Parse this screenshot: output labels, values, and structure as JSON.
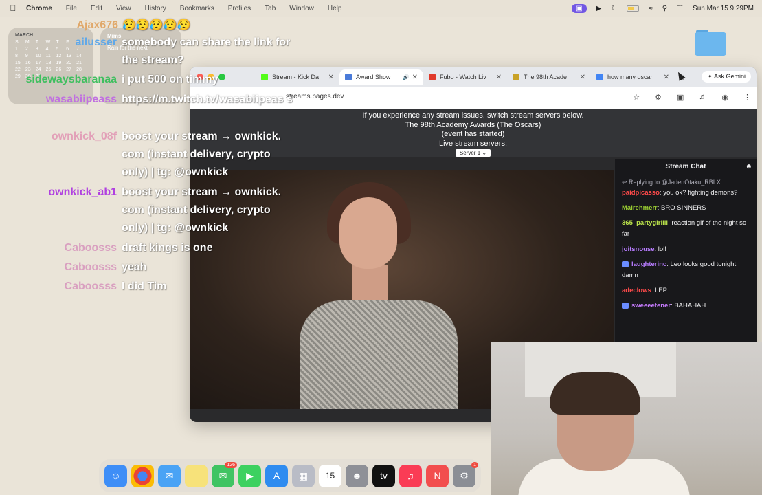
{
  "menubar": {
    "app": "Chrome",
    "items": [
      "File",
      "Edit",
      "View",
      "History",
      "Bookmarks",
      "Profiles",
      "Tab",
      "Window",
      "Help"
    ],
    "clock": "Sun Mar 15  9:29PM"
  },
  "desktop": {
    "calendar_month": "MARCH",
    "calendar_days": [
      "S",
      "M",
      "T",
      "W",
      "T",
      "F",
      "S",
      "1",
      "2",
      "3",
      "4",
      "5",
      "6",
      "7",
      "8",
      "9",
      "10",
      "11",
      "12",
      "13",
      "14",
      "15",
      "16",
      "17",
      "18",
      "19",
      "20",
      "21",
      "22",
      "23",
      "24",
      "25",
      "26",
      "27",
      "28",
      "29",
      "30",
      "31"
    ],
    "weather_city": "Mims",
    "weather_text": "Rain for the next"
  },
  "browser": {
    "tabs": [
      {
        "label": "Stream - Kick Da",
        "icon": "kick-icon",
        "color": "#53fc18"
      },
      {
        "label": "Award Show",
        "icon": "page-icon",
        "color": "#4a7bd9"
      },
      {
        "label": "Fubo - Watch Liv",
        "icon": "fubo-icon",
        "color": "#e0392b"
      },
      {
        "label": "The 98th Acade",
        "icon": "triangle-icon",
        "color": "#c9a227"
      },
      {
        "label": "how many oscar",
        "icon": "google-icon",
        "color": "#4285f4"
      }
    ],
    "ask_gemini": "Ask Gemini",
    "url": "streams.pages.dev",
    "banner": {
      "line1": "If you experience any stream issues, switch stream servers below.",
      "line2": "The 98th Academy Awards (The Oscars)",
      "line3": "(event has started)",
      "line4": "Live stream servers:",
      "server": "Server 1"
    },
    "chat": {
      "title": "Stream Chat",
      "messages": [
        {
          "reply": "Replying to @JadenOtaku_RBLX:...",
          "user": "paidpicasso",
          "text": "you ok? fighting demons?",
          "color": "#ff4a4a",
          "badge": false
        },
        {
          "user": "Mairehmerr",
          "text": "BRO SINNERS",
          "color": "#9acd32",
          "badge": false
        },
        {
          "user": "365_partygirllll",
          "text": "reaction gif of the night so far",
          "color": "#b8e04a",
          "badge": false
        },
        {
          "user": "joitsnouse",
          "text": "lol!",
          "color": "#b77cff",
          "badge": false
        },
        {
          "user": "laughterinc",
          "text": "Leo looks good tonight damn",
          "color": "#b77cff",
          "badge": true
        },
        {
          "user": "adeclows",
          "text": "LEP",
          "color": "#ff4a4a",
          "badge": false
        },
        {
          "user": "sweeeetener",
          "text": "BAHAHAH",
          "color": "#c77cff",
          "badge": true
        }
      ]
    }
  },
  "overlay_chat": [
    {
      "user": "Ajax676",
      "text": "",
      "color": "#e0a86a"
    },
    {
      "user": "ailusser",
      "text": "somebody can share the link for the stream?",
      "color": "#60a8e8"
    },
    {
      "user": "sidewaysbaranaa",
      "text": "i put 500 on timmy",
      "color": "#3fbf5f"
    },
    {
      "user": "wasabiipeass",
      "text": "https://m.twitch.tv/wasabiipeas s",
      "color": "#c070e0"
    },
    {
      "user": "ownkick_08f",
      "text": "boost your stream → ownkick. com (instant delivery, crypto only) | tg: @ownkick",
      "color": "#e2a0b8"
    },
    {
      "user": "ownkick_ab1",
      "text": "boost your stream → ownkick. com (instant delivery, crypto only) | tg: @ownkick",
      "color": "#b040e0"
    },
    {
      "user": "Caboosss",
      "text": "draft kings is one",
      "color": "#d9a0c0"
    },
    {
      "user": "Caboosss",
      "text": "yeah",
      "color": "#d9a0c0"
    },
    {
      "user": "Caboosss",
      "text": "I did Tim",
      "color": "#d9a0c0"
    }
  ],
  "dock": {
    "messages_badge": "126",
    "settings_badge": "1",
    "calendar_day": "15"
  }
}
